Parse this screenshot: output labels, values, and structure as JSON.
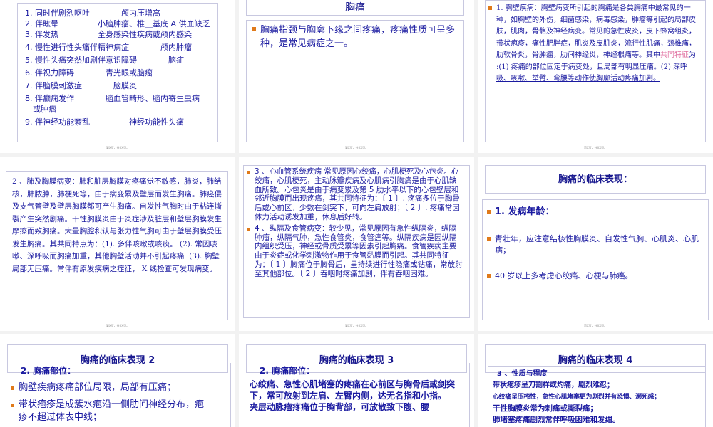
{
  "footer": "第X页，共XX页。",
  "slide1": {
    "lines": [
      "1. 同时伴剧烈呕吐　　　　颅内压增高",
      "2. 伴眩晕　　　　　小脑肿瘤、椎＿基底 A 供血缺乏",
      "3. 伴发热　　　　　全身感染性疾病或颅内感染",
      "4. 慢性进行性头痛伴精神病症　　　　颅内肿瘤",
      "5. 慢性头痛突然加剧伴意识障碍　　　　脑疝",
      "6. 伴视力障碍　　　　青光眼或脑瘤",
      "7. 伴脑膜刺激症　　　　脑膜炎",
      "8. 伴癫痫发作　　　　脑血管畸形、脑内寄生虫病",
      "　或肿瘤",
      "9. 伴神经功能紊乱　　　　　神经功能性头痛"
    ]
  },
  "slide2": {
    "title": "胸痛",
    "body": "胸痛指颈与胸廓下缘之间疼痛，疼痛性质可呈多种，是常见病症之一。"
  },
  "slide3": {
    "part1": "1. 胸壁疾病：胸壁病变所引起的胸痛是各类胸痛中最常见的一种，如胸壁的外伤，细菌感染，病毒感染，肿瘤等引起的局部皮肤，肌肉，骨骼及神经病变。常见的急性皮炎，皮下蜂窝组炎，带状疱疹，痛性肥胖症，肌炎及皮肌炎，流行性肌痛，颈椎痛，肋软骨炎，骨肿瘤，肋间神经炎，神经根痛等。其中",
    "highlight": "共同特征",
    "part2": "为 :(1) 疼痛的部位固定于病变处，且局部有明显压痛。(2) 深呼吸、咳嗽、举臂、弯腰等动作使胸廓活动疼痛加剧。"
  },
  "slide4": {
    "body": "2 、肺及胸膜病变：肺和脏层胸膜对疼痛觉不敏感，肺炎，肺结核，肺脓肿，肺梗死等，由于病变累及壁层而发生胸痛。肺癌侵及支气管壁及壁层胸膜都可产生胸痛。自发性气胸时由于粘连撕裂产生突然剧痛。干性胸膜炎由于炎症涉及脏层和壁层胸膜发生摩擦而致胸痛。大量胸腔积认与张力性气胸可由于壁层胸膜受压发生胸痛。其共同特点为：(1). 多伴咳嗽或咳痰。 (2). 常因咳嗽、深呼吸而胸痛加重，其他胸壁活动并不引起疼痛 .(3). 胸壁局部无压痛。常伴有原发疾病之症征， X 线检查可发现病变。"
  },
  "slide5": {
    "item1": "3 、心血管系统疾病 常见原因心绞痛，心肌梗死及心包炎。心绞痛，心肌梗死，主动脉瓣疾病及心肌病引胸痛是由于心肌缺血所致。心包炎是由于病变累及第 5 肋水平以下的心包壁层和邻近胸膜而出现疼痛，其共同特征为：〔 1 〕. 疼痛多位于胸骨后或心前区，少数在剑突下，可向左肩放射；〔 2 〕. 疼痛常因体力活动诱发加重，休息后好转。",
    "item2": "4 、纵隔及食管病变：较少见，常见原因有急性纵隔炎，纵隔肿瘤，纵隔气肿，急性食管炎，食管癌等。纵隔疾病是因纵隔内组织受压，神经或骨质受累等因素引起胸痛。食管疾病主要由于炎症或化学刺激物作用于食管黏膜而引起。其共同特征为：〔 1 〕胸痛位于胸骨后，呈持续进行性隐痛或钻痛，常放射至其他部位。〔 2 〕吞咽时疼痛加剧，伴有吞咽困难。"
  },
  "slide6": {
    "title": "胸痛的临床表现：",
    "heading": "1. 发病年龄：",
    "b1": "青壮年，应注意结核性胸膜炎、自发性气胸、心肌炎、心肌病；",
    "b2": "40 岁以上多考虑心绞痛、心梗与肺癌。"
  },
  "slide7": {
    "title": "胸痛的临床表现 2",
    "heading": "2. 胸痛部位：",
    "b1_plain": "胸壁疾病疼痛",
    "b1_u": "部位局限，局部有压痛",
    "b1_end": "；",
    "b2_plain": "带状疱疹是成簇水疱",
    "b2_u": "沿一侧肋间神经分布，疱",
    "b2_line2": "疹不超过体表中线；"
  },
  "slide8": {
    "title": "胸痛的临床表现 3",
    "heading": "2. 胸痛部位：",
    "p1": "心绞痛、急性心肌堵塞的疼痛在心前区与胸骨后或剑突下，常可放射到左肩、左臂内侧，达无名指和小指。",
    "p2": "夹层动脉瘤疼痛位于胸背部，可放散致下腹、腰"
  },
  "slide9": {
    "title": "胸痛的临床表现 4",
    "heading": "3 、性质与程度",
    "l1": "带状疱疹呈刀割样或灼痛，剧烈难忍；",
    "l2": "心绞痛呈压榨性，急性心肌堵塞更为剧烈并有恐惧、濒死感；",
    "l3": "干性胸膜炎常为刺痛或撕裂痛；",
    "l4": "肺堵塞疼痛剧烈常伴呼吸困难和发绀。"
  }
}
